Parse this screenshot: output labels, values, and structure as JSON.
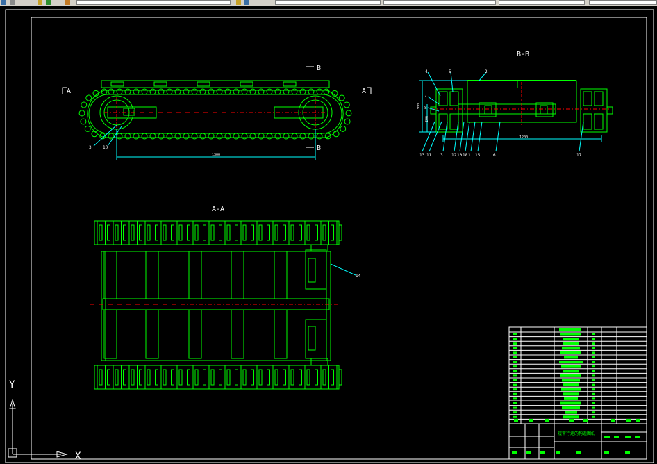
{
  "toolbar": {
    "segments": [
      "",
      "",
      "",
      "",
      "",
      "",
      ""
    ],
    "colors": {
      "face": "#d4d0c8",
      "field": "#ffffff"
    }
  },
  "drawing": {
    "background": "#000000",
    "border_color": "#ffffff",
    "line_color": "#00ff00",
    "dim_color": "#00ffff",
    "center_color": "#ff0000",
    "section_aa": "A-A",
    "section_bb": "B-B",
    "marker_a": "A",
    "marker_b": "B",
    "dim_track_length": "1300",
    "dim_bb_width": "1200",
    "dim_bb_height_1": "300",
    "dim_bb_height_2": "206",
    "leader_label_aa": "14",
    "leader_labels_front": [
      "3",
      "10"
    ],
    "leader_labels_bb_top": [
      "4",
      "5",
      "2",
      "7",
      "8"
    ],
    "leader_labels_bb_bottom": [
      "13",
      "11",
      "3",
      "12",
      "10",
      "18",
      "1",
      "15",
      "6",
      "17"
    ],
    "title_block_title": "履带行走的构造图纸"
  },
  "ucs": {
    "x_label": "X",
    "y_label": "Y"
  }
}
